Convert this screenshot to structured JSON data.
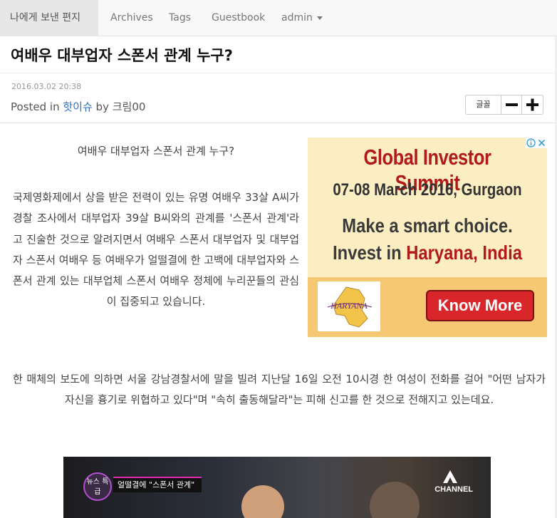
{
  "nav": {
    "brand": "나에게 보낸 편지",
    "items": [
      "Archives",
      "Tags",
      "Guestbook",
      "admin"
    ]
  },
  "post": {
    "title": "여배우 대부업자 스폰서 관계 누구?",
    "date": "2016.03.02 20:38",
    "posted_prefix": "Posted in",
    "category": "핫이슈",
    "by_prefix": "by",
    "author": "크림00",
    "font_label": "글꼴",
    "font_minus": "−",
    "font_plus": "+",
    "lead": "여배우 대부업자 스폰서 관계 누구?",
    "para1": "국제영화제에서 상을 받은 전력이 있는 유명 여배우 33살 A씨가 경찰 조사에서 대부업자 39살 B씨와의 관계를 '스폰서 관계'라고 진술한 것으로 알려지면서 여배우 스폰서 대부업자 및 대부업자 스폰서 여배우 등 여배우가 얼떨결에 한 고백에 대부업자와 스폰서 관계 있는 대부업체 스폰서 여배우 정체에 누리꾼들의 관심이 집중되고 있습니다.",
    "para2": "한 매체의 보도에 의하면 서울 강남경찰서에 말을 빌려 지난달 16일 오전 10시경 한 여성이 전화를 걸어 \"어떤 남자가 자신을 흉기로 위협하고 있다\"며 \"속히 출동해달라\"는 피해 신고를 한 것으로 전해지고 있는데요."
  },
  "ad": {
    "title": "Global Investor Summit",
    "date": "07-08 March 2016, Gurgaon",
    "line1": "Make a smart choice.",
    "line2_prefix": "Invest in ",
    "line2_highlight": "Haryana, India",
    "logo_text": "HARYANA",
    "cta": "Know More"
  },
  "video": {
    "badge": "뉴스 특급",
    "caption": "얼떨결에 \"스폰서 관계\"",
    "channel": "CHANNEL"
  },
  "colors": {
    "link": "#2a6ebd",
    "ad_red": "#b01a1a",
    "ad_bg": "#fbeec3"
  }
}
